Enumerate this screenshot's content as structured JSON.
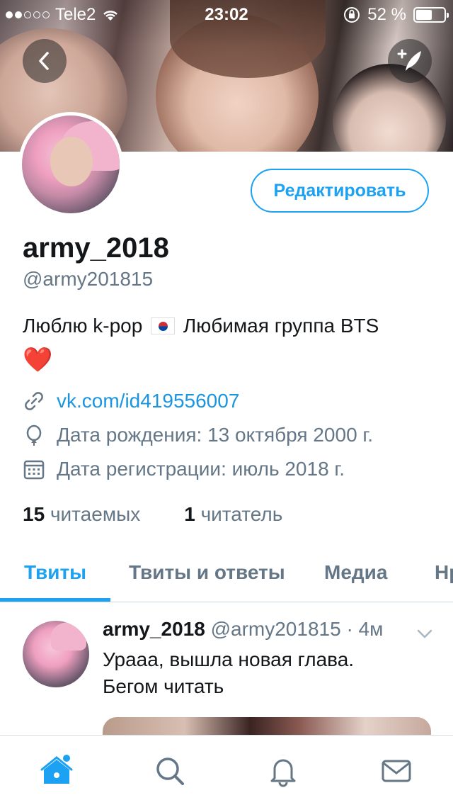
{
  "status_bar": {
    "carrier": "Tele2",
    "time": "23:02",
    "battery": "52 %",
    "battery_level": 0.52
  },
  "profile": {
    "display_name": "army_2018",
    "handle": "@army201815",
    "edit_label": "Редактировать",
    "bio_text_1": "Люблю k-pop",
    "bio_text_2": "Любимая группа BTS",
    "bio_emoji_flag": "kr-flag-icon",
    "bio_emoji_heart": "❤️",
    "link": "vk.com/id419556007",
    "birthday": "Дата рождения: 13 октября 2000 г.",
    "joined": "Дата регистрации: июль 2018 г.",
    "following_count": "15",
    "following_label": "читаемых",
    "followers_count": "1",
    "followers_label": "читатель"
  },
  "tabs": [
    {
      "label": "Твиты",
      "active": true
    },
    {
      "label": "Твиты и ответы",
      "active": false
    },
    {
      "label": "Медиа",
      "active": false
    },
    {
      "label": "Нр",
      "active": false
    }
  ],
  "tweet": {
    "name": "army_2018",
    "handle": "@army201815",
    "time": "· 4м",
    "text_line1": "Урааа, вышла новая глава.",
    "text_line2": "Бегом читать"
  },
  "icons": {
    "back": "back-chevron-icon",
    "compose": "compose-tweet-icon",
    "link": "link-icon",
    "birthday": "balloon-icon",
    "calendar": "calendar-icon",
    "home": "home-icon",
    "search": "search-icon",
    "notifications": "bell-icon",
    "messages": "envelope-icon"
  },
  "colors": {
    "accent": "#1da1f2",
    "secondary_text": "#657786",
    "heart": "#e0245e"
  }
}
